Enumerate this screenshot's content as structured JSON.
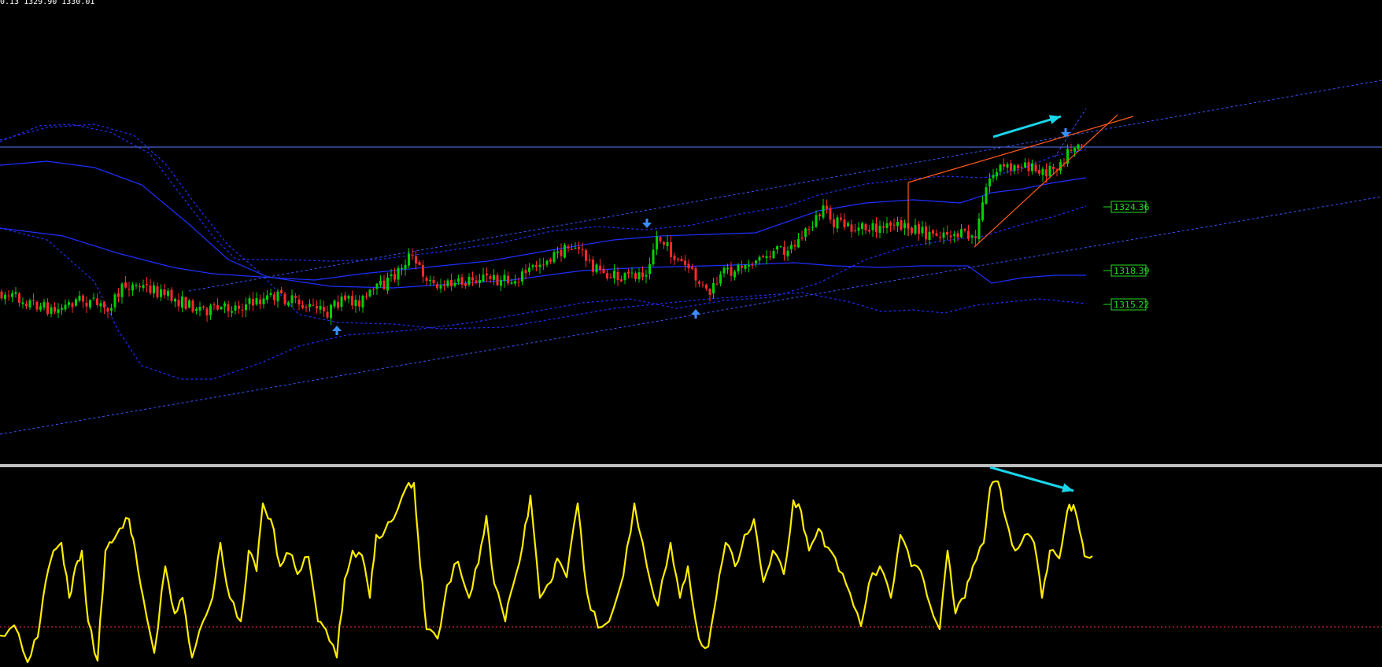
{
  "header": {
    "ohlc_text": "0.13 1329.90 1330.01"
  },
  "colors": {
    "background": "#000000",
    "bull_candle": "#00d000",
    "bear_candle": "#ff2a2a",
    "band_blue": "#1f2fff",
    "channel_blue": "#3b55ff",
    "resistance_line": "#5a7bff",
    "wedge_orange": "#ff5a1e",
    "signal_arrow": "#3a8fff",
    "annotation_cyan": "#19d6ec",
    "oscillator_yellow": "#ffee00",
    "oscillator_level": "#ff2a55",
    "price_label": "#22dd22"
  },
  "chart_data": [
    {
      "type": "candlestick",
      "title": "",
      "price_labels": [
        "1324.36",
        "1318.39",
        "1315.22"
      ],
      "resistance_level": 1329.9,
      "signals": [
        {
          "kind": "buy",
          "bar": 88
        },
        {
          "kind": "sell",
          "bar": 170
        },
        {
          "kind": "buy",
          "bar": 182
        },
        {
          "kind": "sell",
          "bar": 280
        }
      ],
      "grid": false
    },
    {
      "type": "line",
      "title": "",
      "series": [
        {
          "values": []
        }
      ],
      "level_line": true,
      "grid": false
    }
  ]
}
